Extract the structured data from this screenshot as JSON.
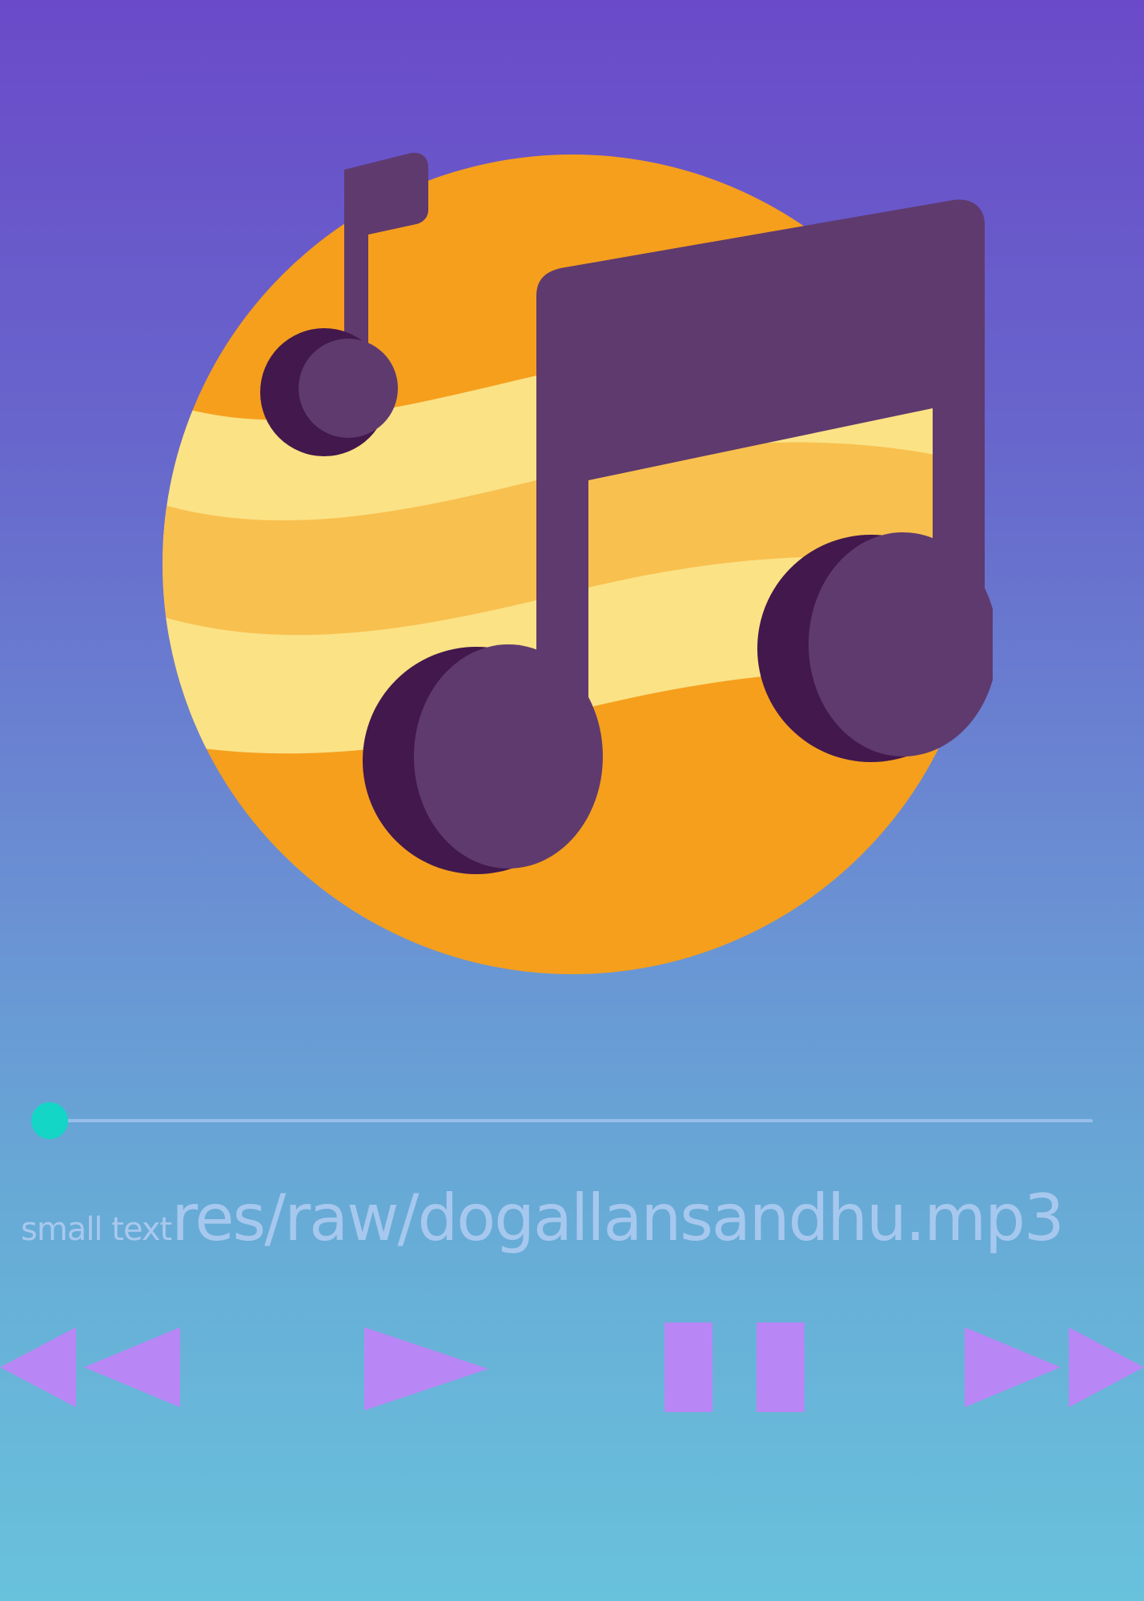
{
  "player": {
    "album_art_icon": "music-note-icon",
    "seek": {
      "progress": 0.0
    },
    "small_label": "small text",
    "file_path": "res/raw/dogallansandhu.mp3",
    "controls": {
      "rewind_icon": "rewind-icon",
      "play_icon": "play-icon",
      "pause_icon": "pause-icon",
      "forward_icon": "fast-forward-icon"
    }
  },
  "colors": {
    "gradient_top": "#6a4ac9",
    "gradient_bottom": "#68c2dc",
    "accent_thumb": "#14d6c6",
    "control_buttons": "#b887f5",
    "text": "#a7c8ee",
    "art_orange": "#f59f1d",
    "art_purple": "#5f3a6e",
    "art_dark_purple": "#42184d"
  }
}
